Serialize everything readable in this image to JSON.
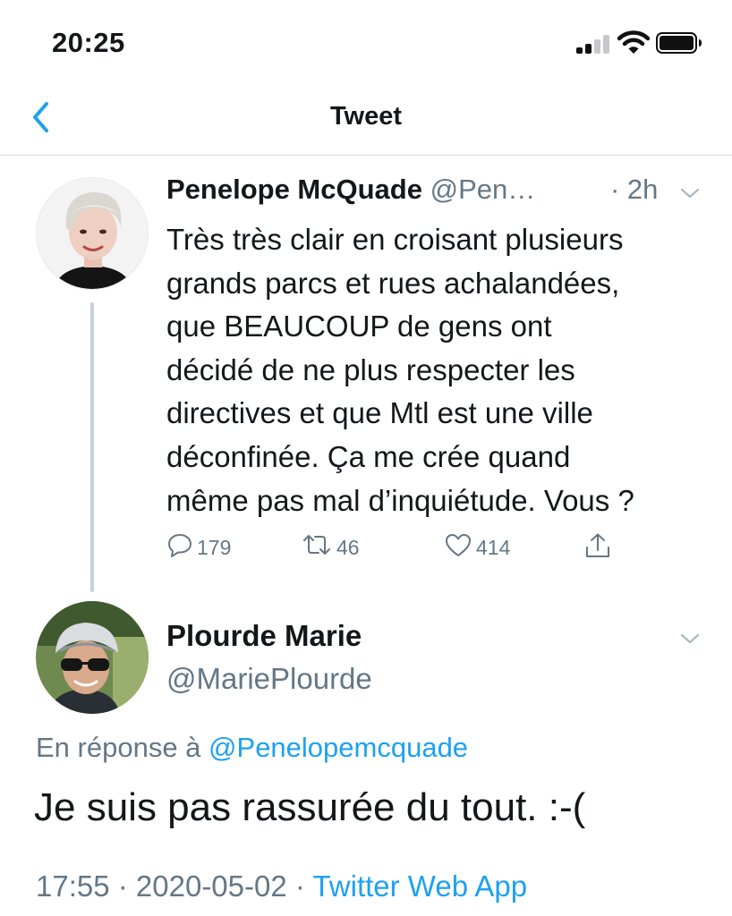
{
  "status_bar": {
    "time": "20:25",
    "icons": [
      "signal-icon",
      "wifi-icon",
      "battery-icon"
    ]
  },
  "nav": {
    "back_icon": "chevron-left-icon",
    "title": "Tweet"
  },
  "parent_tweet": {
    "name": "Penelope McQuade",
    "handle": "@Pen…",
    "time": "· 2h",
    "text_lines": [
      "Très très clair en croisant plusieurs",
      "grands parcs et rues achalandées,",
      "que BEAUCOUP de gens ont",
      "décidé de ne plus respecter les",
      "directives et que Mtl est une ville",
      "déconfinée. Ça me crée quand",
      "même pas mal d’inquiétude. Vous ?"
    ],
    "actions": {
      "replies": "179",
      "retweets": "46",
      "likes": "414"
    }
  },
  "reply_tweet": {
    "name": "Plourde Marie",
    "handle": "@MariePlourde",
    "in_reply_prefix": "En réponse à",
    "in_reply_handle": "@Penelopemcquade",
    "text": "Je suis pas rassurée du tout. :-(",
    "timestamp": "17:55 · 2020-05-02 · ",
    "source": "Twitter Web App"
  },
  "colors": {
    "accent": "#1da1f2",
    "secondary_text": "#657786",
    "primary_text": "#14171a"
  }
}
